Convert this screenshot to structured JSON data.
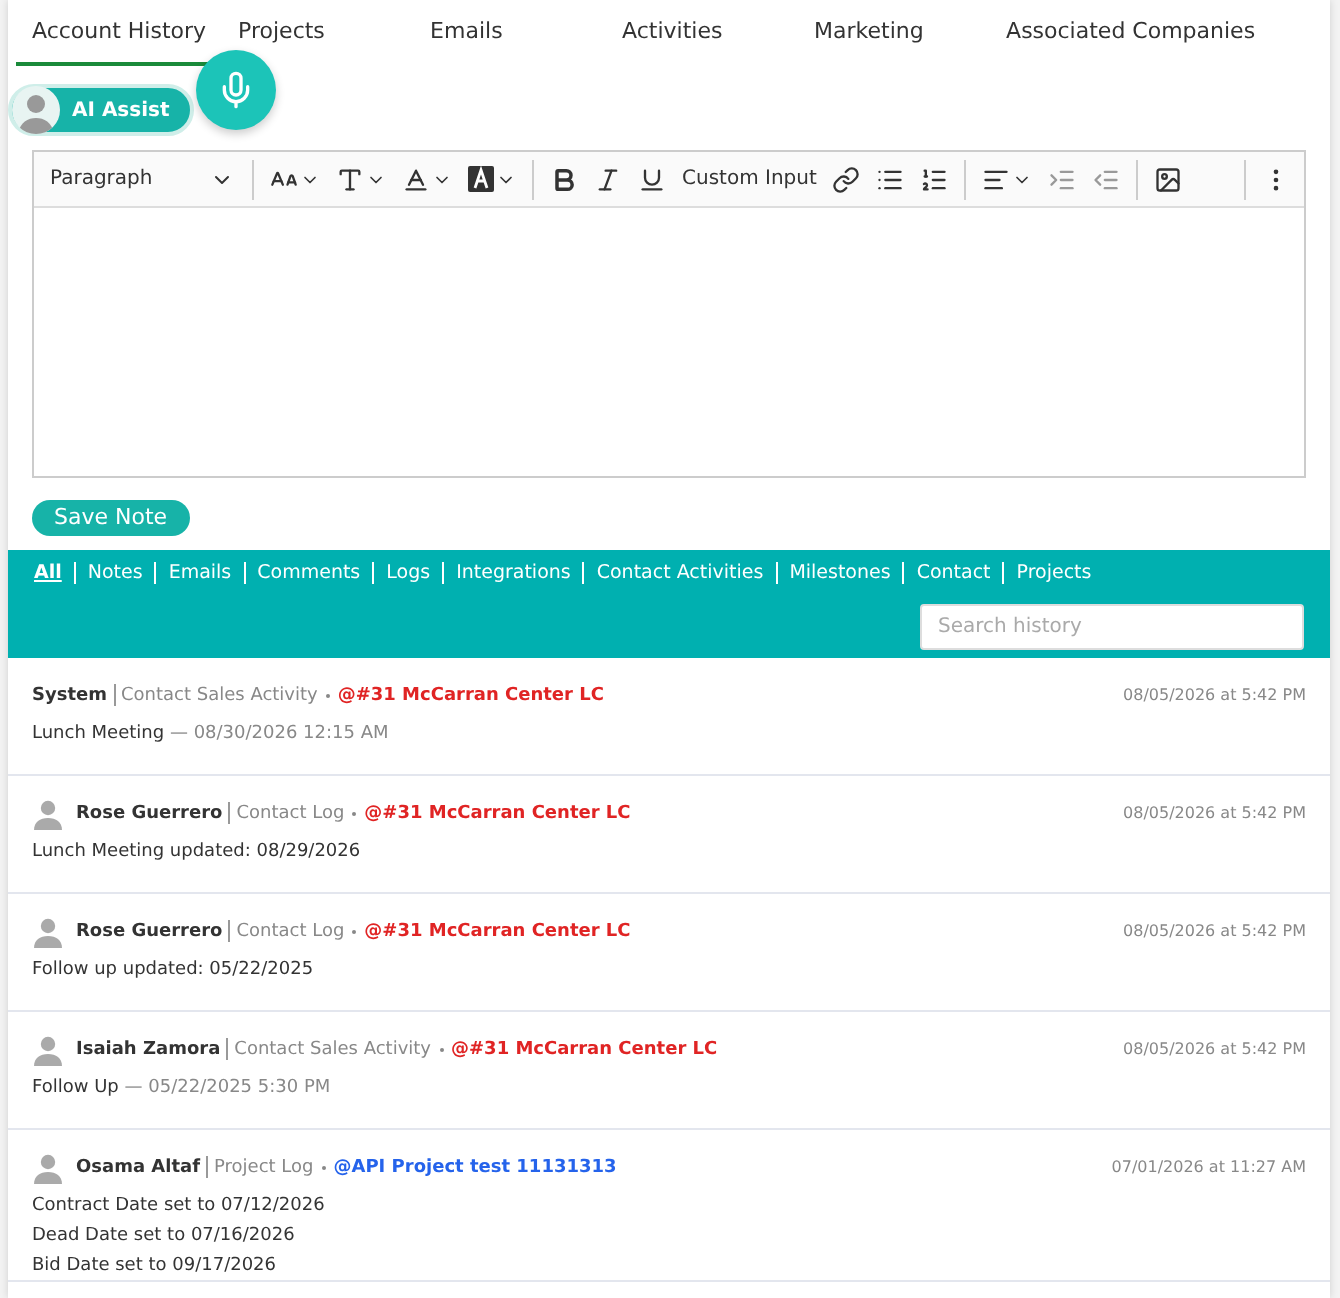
{
  "tabs": [
    {
      "label": "Account History",
      "selected": true
    },
    {
      "label": "Projects",
      "selected": false
    },
    {
      "label": "Emails",
      "selected": false
    },
    {
      "label": "Activities",
      "selected": false
    },
    {
      "label": "Marketing",
      "selected": false
    },
    {
      "label": "Associated Companies",
      "selected": false
    }
  ],
  "ai_assist": {
    "label": "AI Assist"
  },
  "editor": {
    "block_format": "Paragraph",
    "custom_button": "Custom Input"
  },
  "save_button": "Save Note",
  "filters": [
    {
      "label": "All",
      "selected": true
    },
    {
      "label": "Notes",
      "selected": false
    },
    {
      "label": "Emails",
      "selected": false
    },
    {
      "label": "Comments",
      "selected": false
    },
    {
      "label": "Logs",
      "selected": false
    },
    {
      "label": "Integrations",
      "selected": false
    },
    {
      "label": "Contact Activities",
      "selected": false
    },
    {
      "label": "Milestones",
      "selected": false
    },
    {
      "label": "Contact",
      "selected": false
    },
    {
      "label": "Projects",
      "selected": false
    }
  ],
  "search": {
    "placeholder": "Search history"
  },
  "entries": [
    {
      "avatar": false,
      "author": "System",
      "source": "Contact Sales Activity",
      "link": "@#31 McCarran Center LC",
      "color": "#e02424",
      "time": "08/05/2026 at 5:42 PM",
      "lines": [
        {
          "text": "Lunch Meeting",
          "detail": "— 08/30/2026 12:15 AM"
        }
      ]
    },
    {
      "avatar": true,
      "author": "Rose Guerrero",
      "source": "Contact Log",
      "link": "@#31 McCarran Center LC",
      "color": "#e02424",
      "time": "08/05/2026 at 5:42 PM",
      "lines": [
        {
          "text": "Lunch Meeting updated: 08/29/2026"
        }
      ]
    },
    {
      "avatar": true,
      "author": "Rose Guerrero",
      "source": "Contact Log",
      "link": "@#31 McCarran Center LC",
      "color": "#e02424",
      "time": "08/05/2026 at 5:42 PM",
      "lines": [
        {
          "text": "Follow up updated: 05/22/2025"
        }
      ]
    },
    {
      "avatar": true,
      "author": "Isaiah Zamora",
      "source": "Contact Sales Activity",
      "link": "@#31 McCarran Center LC",
      "color": "#e02424",
      "time": "08/05/2026 at 5:42 PM",
      "lines": [
        {
          "text": "Follow Up",
          "detail": "— 05/22/2025 5:30 PM"
        }
      ]
    },
    {
      "avatar": true,
      "author": "Osama Altaf",
      "source": "Project Log",
      "link": "@API Project test 11131313",
      "color": "#2563eb",
      "time": "07/01/2026 at 11:27 AM",
      "lines": [
        {
          "text": "Contract Date set to 07/12/2026"
        },
        {
          "text": "Dead Date set to 07/16/2026"
        },
        {
          "text": "Bid Date set to 09/17/2026"
        }
      ]
    }
  ]
}
